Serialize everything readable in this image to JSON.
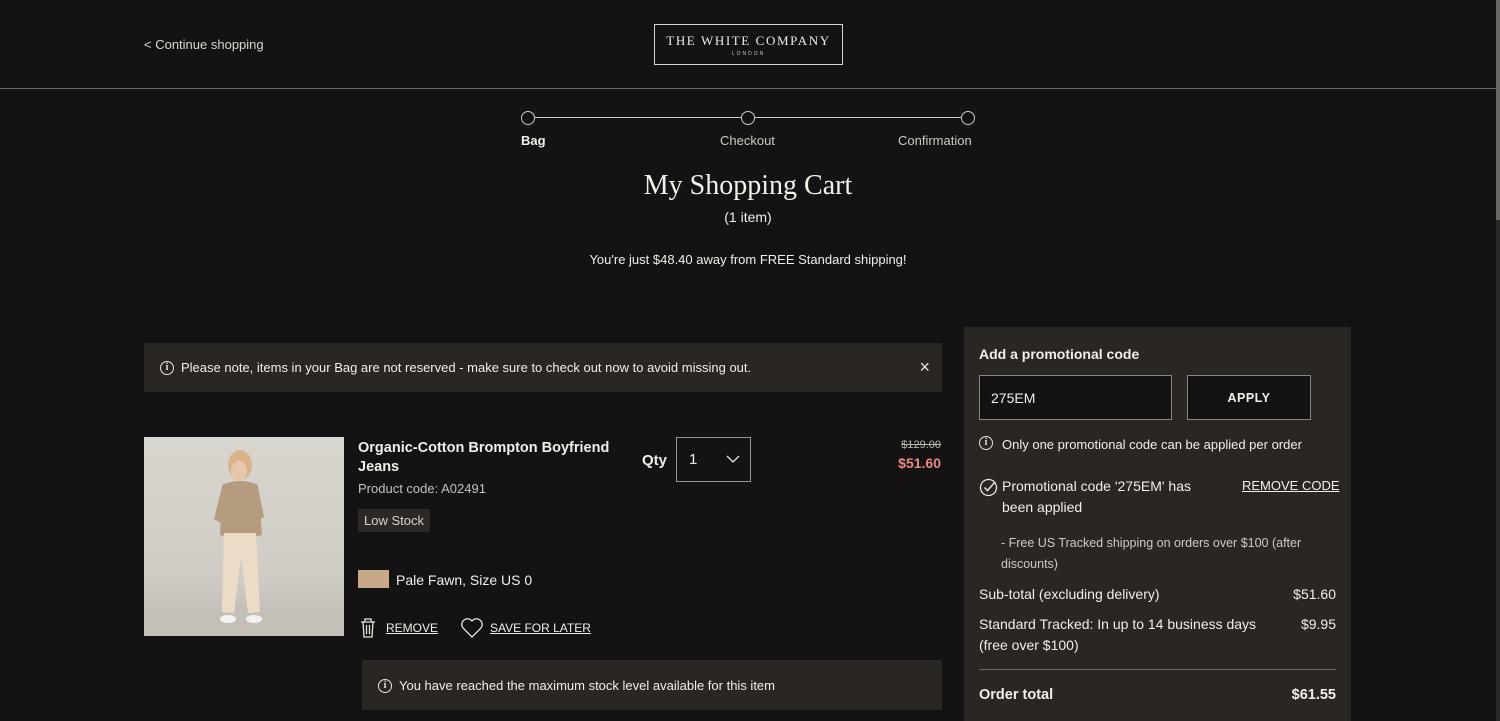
{
  "header": {
    "continue_link": "< Continue shopping",
    "logo_line1": "THE WHITE COMPANY",
    "logo_line2": "LONDON"
  },
  "stepper": {
    "steps": [
      {
        "label": "Bag",
        "active": true
      },
      {
        "label": "Checkout",
        "active": false
      },
      {
        "label": "Confirmation",
        "active": false
      }
    ]
  },
  "page": {
    "title": "My Shopping Cart",
    "item_count": "(1 item)",
    "shipping_message": "You're just $48.40 away from FREE Standard shipping!"
  },
  "notice": {
    "text": "Please note, items in your Bag are not reserved - make sure to check out now to avoid missing out.",
    "close_icon": "×"
  },
  "product": {
    "name": "Organic-Cotton Brompton Boyfriend Jeans",
    "code": "Product code: A02491",
    "stock_badge": "Low Stock",
    "variant": "Pale Fawn, Size US 0",
    "swatch_color": "#c6a989",
    "qty_label": "Qty",
    "qty_value": "1",
    "price_original": "$129.00",
    "price_sale": "$51.60",
    "remove_label": "REMOVE",
    "save_label": "SAVE FOR LATER",
    "max_stock_message": "You have reached the maximum stock level available for this item"
  },
  "summary": {
    "promo_title": "Add a promotional code",
    "promo_value": "275EM",
    "apply_label": "APPLY",
    "promo_note": "Only one promotional code can be applied per order",
    "applied_text": "Promotional code '275EM' has been applied",
    "remove_code_label": "REMOVE CODE",
    "promo_description": "- Free US Tracked shipping on orders over $100 (after discounts)",
    "subtotal_label": "Sub-total (excluding delivery)",
    "subtotal_value": "$51.60",
    "shipping_label": "Standard Tracked: In up to 14 business days (free over $100)",
    "shipping_value": "$9.95",
    "total_label": "Order total",
    "total_value": "$61.55"
  },
  "colors": {
    "background": "#141212",
    "panel": "#2a2624",
    "sale_price": "#e88a84"
  }
}
